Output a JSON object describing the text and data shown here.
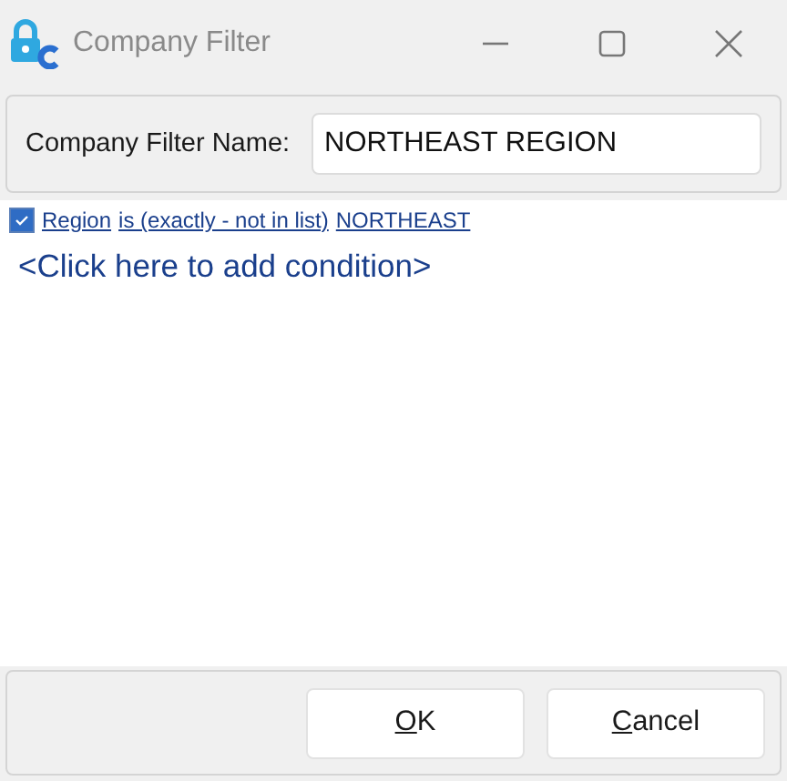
{
  "window": {
    "title": "Company Filter"
  },
  "name_field": {
    "label": "Company Filter Name:",
    "value": "NORTHEAST REGION"
  },
  "conditions": [
    {
      "checked": true,
      "field": "Region",
      "operator": "is (exactly - not in list)",
      "value": "NORTHEAST"
    }
  ],
  "add_condition": "<Click here to add condition>",
  "buttons": [
    {
      "label": "OK"
    },
    {
      "label": "Cancel"
    }
  ]
}
